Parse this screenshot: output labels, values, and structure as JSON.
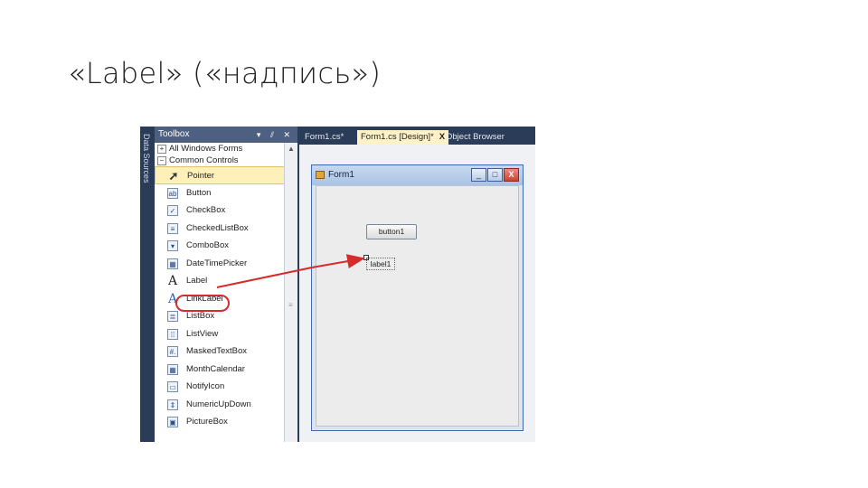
{
  "slide": {
    "title": "«Label» («надпись»)"
  },
  "vertical_strip": {
    "label": "Data Sources"
  },
  "toolbox": {
    "title": "Toolbox",
    "controls": "▾ ⫽ ✕",
    "categories": [
      {
        "expander": "+",
        "label": "All Windows Forms"
      },
      {
        "expander": "−",
        "label": "Common Controls"
      }
    ],
    "items": [
      {
        "label": "Pointer",
        "icon": "pointer-arrow-icon",
        "glyph": "➚"
      },
      {
        "label": "Button",
        "icon": "button-icon",
        "glyph": "ab"
      },
      {
        "label": "CheckBox",
        "icon": "checkbox-icon",
        "glyph": "✓"
      },
      {
        "label": "CheckedListBox",
        "icon": "checkedlistbox-icon",
        "glyph": "≡"
      },
      {
        "label": "ComboBox",
        "icon": "combobox-icon",
        "glyph": "▾"
      },
      {
        "label": "DateTimePicker",
        "icon": "datetimepicker-icon",
        "glyph": "▦"
      },
      {
        "label": "Label",
        "icon": "label-a-icon",
        "glyph": "A"
      },
      {
        "label": "LinkLabel",
        "icon": "linklabel-a-icon",
        "glyph": "A"
      },
      {
        "label": "ListBox",
        "icon": "listbox-icon",
        "glyph": "≣"
      },
      {
        "label": "ListView",
        "icon": "listview-icon",
        "glyph": "⁞⁞"
      },
      {
        "label": "MaskedTextBox",
        "icon": "maskedtextbox-icon",
        "glyph": "#."
      },
      {
        "label": "MonthCalendar",
        "icon": "monthcalendar-icon",
        "glyph": "▦"
      },
      {
        "label": "NotifyIcon",
        "icon": "notifyicon-icon",
        "glyph": "▭"
      },
      {
        "label": "NumericUpDown",
        "icon": "numericupdown-icon",
        "glyph": "⇕"
      },
      {
        "label": "PictureBox",
        "icon": "picturebox-icon",
        "glyph": "▣"
      }
    ],
    "scroll_up": "▲",
    "scroll_grip": "≡"
  },
  "tabs": [
    {
      "label": "Form1.cs*"
    },
    {
      "label": "Form1.cs [Design]*",
      "close": "X"
    },
    {
      "label": "Object Browser"
    }
  ],
  "form": {
    "caption": "Form1",
    "minimize": "_",
    "maximize": "□",
    "close": "X",
    "button_text": "button1",
    "label_text": "label1"
  },
  "colors": {
    "annotation": "#d62b2b",
    "ide_dark": "#2b3c59",
    "selection": "#fdf0b8"
  }
}
